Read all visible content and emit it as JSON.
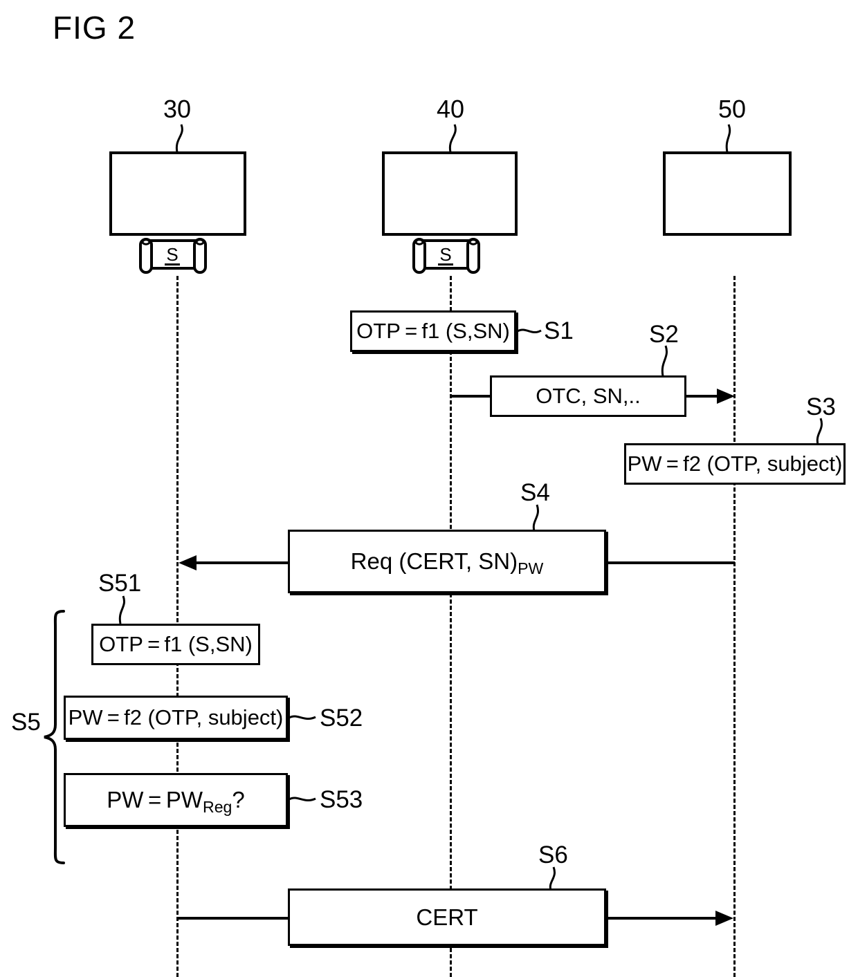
{
  "figure": {
    "title": "FIG 2",
    "type": "sequence-diagram",
    "stroke_color": "#000000",
    "background_color": "#ffffff"
  },
  "entities": [
    {
      "ref": "30",
      "has_secret_icon": true,
      "secret_letter": "S"
    },
    {
      "ref": "40",
      "has_secret_icon": true,
      "secret_letter": "S"
    },
    {
      "ref": "50",
      "has_secret_icon": false,
      "secret_letter": ""
    }
  ],
  "steps": [
    {
      "ref": "S1",
      "text": "OTP = f1 (S,SN)",
      "kind": "computation",
      "on_entity": "40"
    },
    {
      "ref": "S2",
      "text": "OTC, SN,..",
      "kind": "message",
      "from": "40",
      "to": "50",
      "direction": "right"
    },
    {
      "ref": "S3",
      "text": "PW = f2 (OTP, subject)",
      "kind": "computation",
      "on_entity": "50"
    },
    {
      "ref": "S4",
      "text": "Req (CERT, SN)",
      "subscript": "PW",
      "kind": "message",
      "from": "50",
      "to": "30",
      "direction": "left"
    },
    {
      "ref": "S51",
      "text": "OTP = f1 (S,SN)",
      "kind": "computation",
      "on_entity": "30"
    },
    {
      "ref": "S52",
      "text": "PW = f2 (OTP, subject)",
      "kind": "computation",
      "on_entity": "30"
    },
    {
      "ref": "S53",
      "text": "PW = PW",
      "subscript": "Reg",
      "suffix": "?",
      "kind": "computation",
      "on_entity": "30"
    },
    {
      "ref": "S6",
      "text": "CERT",
      "kind": "message",
      "from": "30",
      "to": "50",
      "direction": "right"
    }
  ],
  "group": {
    "ref": "S5",
    "members": [
      "S51",
      "S52",
      "S53"
    ]
  }
}
